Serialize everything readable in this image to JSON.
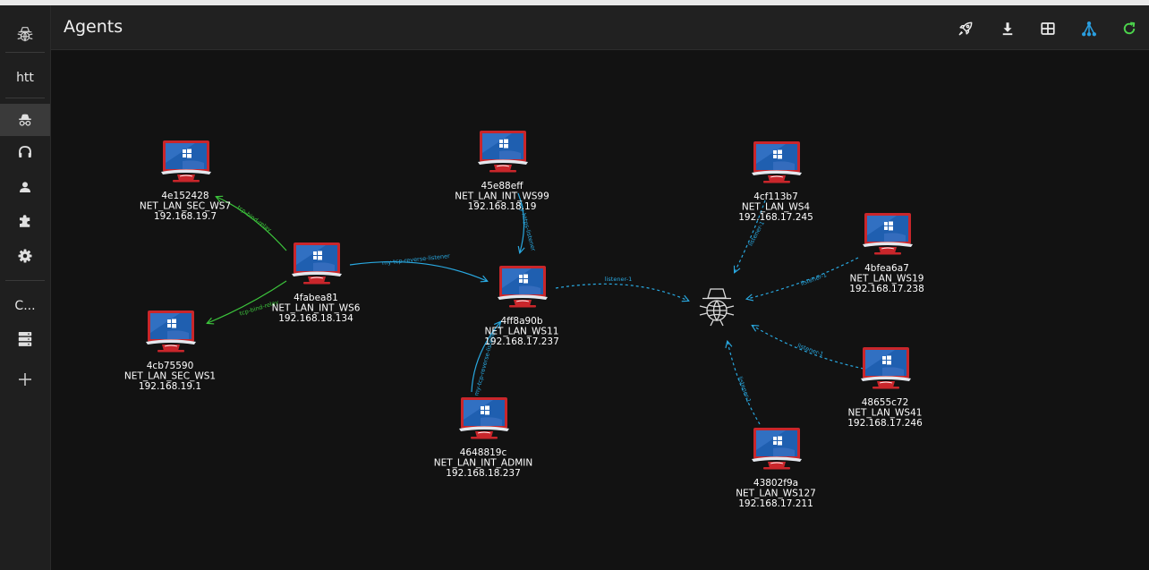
{
  "header": {
    "title": "Agents"
  },
  "sidebar": {
    "items": [
      {
        "label": "htt"
      },
      {
        "label": "C..."
      }
    ]
  },
  "colors": {
    "accent_blue": "#29a8e0",
    "green": "#3cc43c",
    "background": "#121212"
  },
  "toolbar": {
    "icons": [
      "rocket-icon",
      "download-icon",
      "table-icon",
      "graph-icon",
      "refresh-icon"
    ]
  },
  "nodes": [
    {
      "id": "4e152428",
      "name": "NET_LAN_SEC_WS7",
      "ip": "192.168.19.7"
    },
    {
      "id": "4fabea81",
      "name": "NET_LAN_INT_WS6",
      "ip": "192.168.18.134"
    },
    {
      "id": "4cb75590",
      "name": "NET_LAN_SEC_WS1",
      "ip": "192.168.19.1"
    },
    {
      "id": "45e88eff",
      "name": "NET_LAN_INT_WS99",
      "ip": "192.168.18.19"
    },
    {
      "id": "4ff8a90b",
      "name": "NET_LAN_WS11",
      "ip": "192.168.17.237"
    },
    {
      "id": "4648819c",
      "name": "NET_LAN_INT_ADMIN",
      "ip": "192.168.18.237"
    },
    {
      "id": "4cf113b7",
      "name": "NET_LAN_WS4",
      "ip": "192.168.17.245"
    },
    {
      "id": "4bfea6a7",
      "name": "NET_LAN_WS19",
      "ip": "192.168.17.238"
    },
    {
      "id": "48655c72",
      "name": "NET_LAN_WS41",
      "ip": "192.168.17.246"
    },
    {
      "id": "43802f9a",
      "name": "NET_LAN_WS127",
      "ip": "192.168.17.211"
    }
  ],
  "edges": [
    {
      "label": "tcp-bind-relay"
    },
    {
      "label": "tcp-bind-relay"
    },
    {
      "label": "my-tcp-reverse-listener"
    },
    {
      "label": "my-https-listener"
    },
    {
      "label": "my-tcp-reverse-listener"
    },
    {
      "label": "listener-1"
    },
    {
      "label": "listener-1"
    },
    {
      "label": "listener-1"
    },
    {
      "label": "listener-1"
    },
    {
      "label": "listener-1"
    }
  ]
}
